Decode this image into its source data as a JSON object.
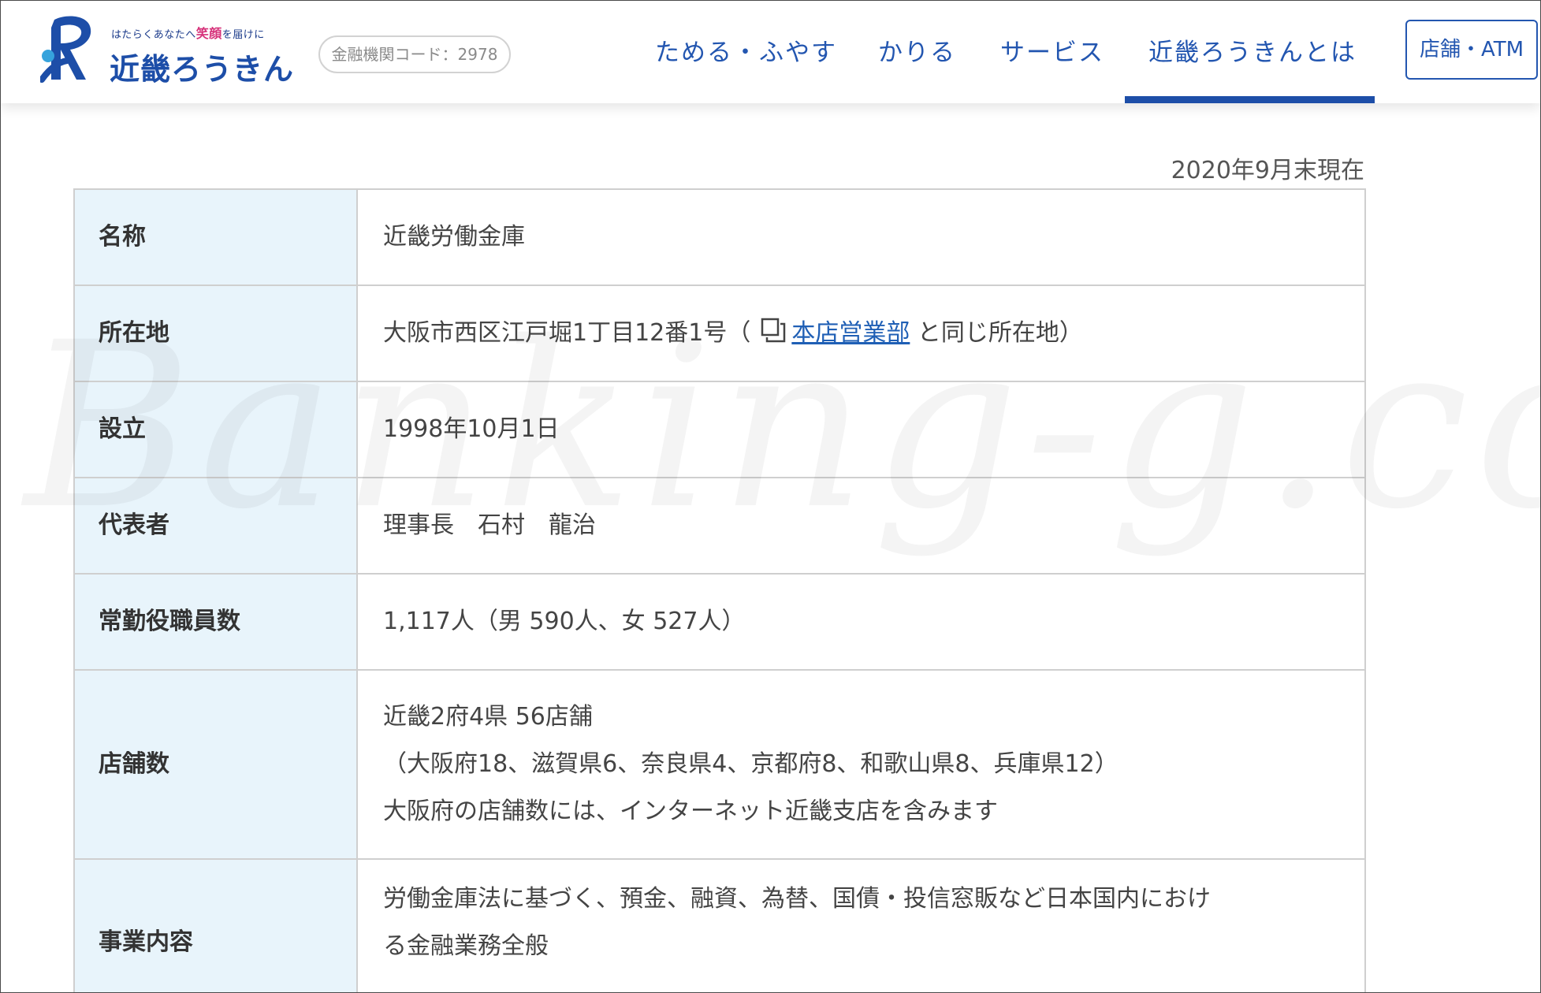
{
  "header": {
    "tagline_before": "はたらくあなたへ",
    "tagline_smile": "笑顔",
    "tagline_after": "を届けに",
    "brand_name": "近畿ろうきん",
    "code_badge": "金融機関コード：2978",
    "nav": [
      {
        "label": "ためる・ふやす"
      },
      {
        "label": "かりる"
      },
      {
        "label": "サービス"
      },
      {
        "label": "近畿ろうきんとは"
      }
    ],
    "atm_button": "店舗・ATM",
    "colors": {
      "brand": "#1d4ea8",
      "accent_pink": "#d6327a",
      "table_header_bg": "#e8f4fb"
    }
  },
  "content": {
    "as_of": "2020年9月末現在",
    "rows": [
      {
        "label": "名称",
        "value": "近畿労働金庫"
      },
      {
        "label": "所在地",
        "value_before": "大阪市西区江戸堀1丁目12番1号（",
        "link": "本店営業部",
        "value_after": "と同じ所在地）"
      },
      {
        "label": "設立",
        "value": "1998年10月1日"
      },
      {
        "label": "代表者",
        "value": "理事長　石村　龍治"
      },
      {
        "label": "常勤役職員数",
        "value": "1,117人（男 590人、女 527人）"
      },
      {
        "label": "店舗数",
        "lines": [
          "近畿2府4県 56店舗",
          "（大阪府18、滋賀県6、奈良県4、京都府8、和歌山県8、兵庫県12）",
          "大阪府の店舗数には、インターネット近畿支店を含みます"
        ]
      },
      {
        "label": "事業内容",
        "lines": [
          "労働金庫法に基づく、預金、融資、為替、国債・投信窓販など日本国内におけ",
          "る金融業務全般"
        ]
      }
    ]
  },
  "watermark": "Banking-g.com"
}
